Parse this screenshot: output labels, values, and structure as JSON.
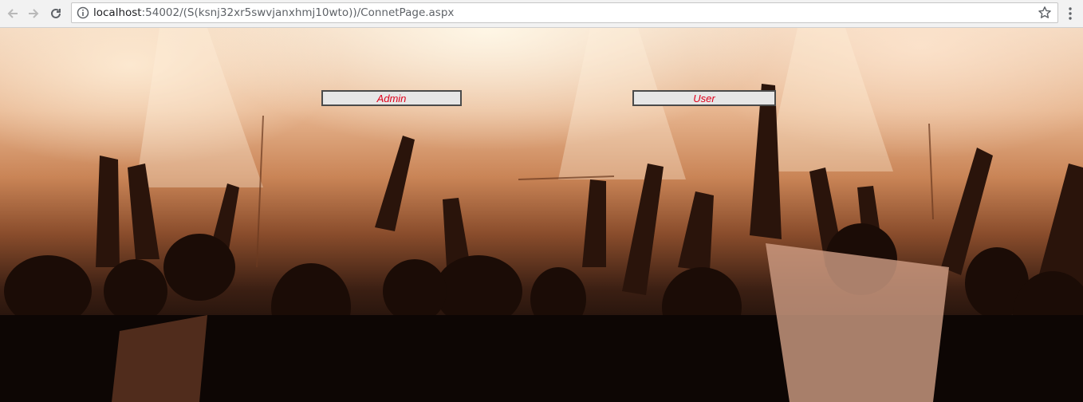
{
  "browser": {
    "url_host": "localhost",
    "url_rest": ":54002/(S(ksnj32xr5swvjanxhmj10wto))/ConnetPage.aspx",
    "icons": {
      "back": "arrow-left-icon",
      "forward": "arrow-right-icon",
      "reload": "reload-icon",
      "info": "info-icon",
      "bookmark": "star-icon",
      "menu": "more-vert-icon"
    }
  },
  "page": {
    "background": "concert crowd photo",
    "buttons": {
      "admin": "Admin",
      "user": "User"
    },
    "colors": {
      "button_text": "#e0001a",
      "button_bg": "#e6e6e6",
      "button_border": "#4a4a4a"
    }
  }
}
